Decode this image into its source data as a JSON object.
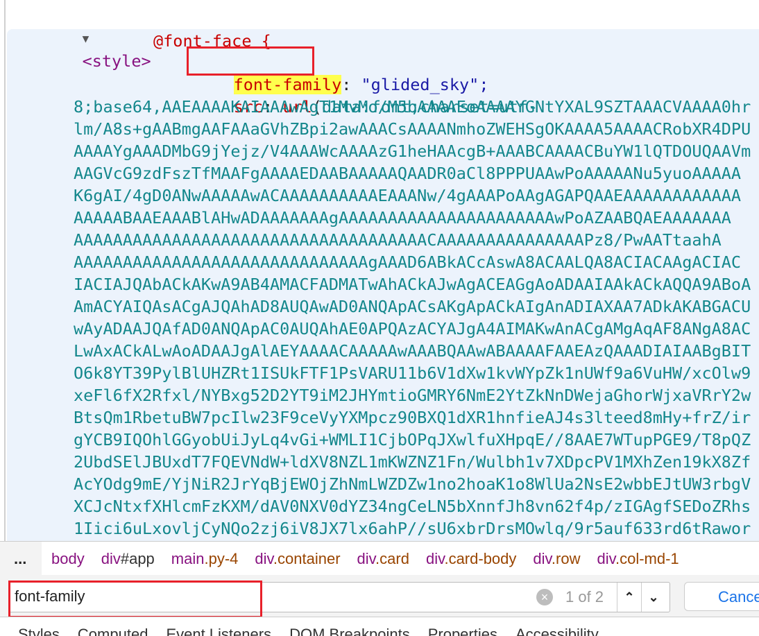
{
  "elements_tree": {
    "style_tag": "<style>",
    "at_rule": "@font-face {",
    "font_family_prop": "font-family",
    "font_family_colon": ":",
    "font_family_value": " \"glided_sky\";",
    "src_prop": "src",
    "src_colon": ": ",
    "src_url": "url",
    "src_paren": "(",
    "src_start": "data:font;charset=utf-",
    "base64_lines": [
      "8;base64,AAEAAAAKAIAAAwAgT1MvMo/M5bAAAAEoAAAAYGNtYXAL9SZTAAACVAAAA0hr",
      "lm/A8s+gAABmgAAFAAaGVhZBpi2awAAACsAAAANmhoZWEHSgOKAAAA5AAAACRobXR4DPU",
      "AAAAYgAAADMbG9jYejz/V4AAAWcAAAAzG1heHAAcgB+AAABCAAAACBuYW1lQTDOUQAAVm",
      "AAGVcG9zdFszTfMAAFgAAAAEDAABAAAAAQAADR0aCl8PPPUAAwPoAAAAANu5yuoAAAAA",
      "K6gAI/4gD0ANwAAAAAwACAAAAAAAAAAEAAANw/4gAAAPoAAgAGAPQAAEAAAAAAAAAAAA",
      "AAAAABAAEAAABlAHwADAAAAAAAgAAAAAAAAAAAAAAAAAAAAAAwPoAZAABQAEAAAAAAA",
      "AAAAAAAAAAAAAAAAAAAAAAAAAAAAAAAAAAAACAAAAAAAAAAAAAAAPz8/PwAATtaahA",
      "AAAAAAAAAAAAAAAAAAAAAAAAAAAAAAgAAAD6ABkACcAswA8ACAALQA8ACIACAAgACIAC",
      "IACIAJQAbACkAKwA9AB4AMACFADMATwAhACkAJwAgACEAGgAoADAAIAAkACkAQQA9ABoA",
      "AmACYAIQAsACgAJQAhAD8AUQAwAD0ANQApACsAKgApACkAIgAnADIAXAA7ADkAKABGACU",
      "wAyADAAJQAfAD0ANQApAC0AUQAhAE0APQAzACYAJgA4AIMAKwAnACgAMgAqAF8ANgA8AC",
      "LwAxACkALwAoADAAJgAlAEYAAAACAAAAAwAAABQAAwABAAAAFAAEAzQAAADIAIAABgBIT",
      "O6k8YT39PylBlUHZRt1ISUkFTF1PsVARU11b6V1dXw1kvWYpZk1nUWf9a6VuHW/xcOlw9",
      "xeFl6fX2Rfxl/NYBxg52D2YT9iM2JHYmtioGMRY6NmE2YtZkNnDWejaGhorWjxaVRrY2w",
      "BtsQm1RbetuBW7pcIlw23F9ceVyYXMpcz90BXQ1dXR1hnfieAJ4s3lteed8mHy+frZ/ir",
      "gYCB9IQOhlGGyobUiJyLq4vGi+WMLI1CjbOPqJXwlfuXHpqE//8AAE7WTupPGE9/T8pQZ",
      "2UbdSElJBUxdT7FQEVNdW+ldXV8NZL1mKWZNZ1Fn/Wulbh1v7XDpcPV1MXhZen19kX8Zf",
      "AcYOdg9mE/YjNiR2JrYqBjEWOjZhNmLWZDZw1no2hoaK1o8WlUa2NsE2wbbEJtUW3rbgV",
      "XCJcNtxfXHlcmFzKXM/dAV0NXV0dYZ34ngCeLN5bXnnfJh8vn62f4p/zIGAgfSEDoZRhs",
      "1Iici6uLxovljCyNQo2zj6iV8JX7lx6ahP//sU6xbrDrsMOwlq/9r5auf633rd6tRawor"
    ]
  },
  "breadcrumbs": {
    "overflow": "...",
    "items": [
      {
        "tag": "body",
        "cls": ""
      },
      {
        "tag": "div",
        "cls": "#app"
      },
      {
        "tag": "main",
        "cls": ".py-4"
      },
      {
        "tag": "div",
        "cls": ".container"
      },
      {
        "tag": "div",
        "cls": ".card"
      },
      {
        "tag": "div",
        "cls": ".card-body"
      },
      {
        "tag": "div",
        "cls": ".row"
      },
      {
        "tag": "div",
        "cls": ".col-md-1"
      }
    ]
  },
  "search": {
    "value": "font-family",
    "match_count": "1 of 2",
    "clear_icon": "×",
    "prev_icon": "⌃",
    "next_icon": "⌄",
    "cancel_label": "Cancel"
  },
  "panel_tabs": [
    "Styles",
    "Computed",
    "Event Listeners",
    "DOM Breakpoints",
    "Properties",
    "Accessibility"
  ],
  "colors": {
    "highlight": "#ffff4d",
    "annotation_box": "#e8202a",
    "base64_text": "#13878c",
    "selected_row": "#ecf3fc"
  }
}
